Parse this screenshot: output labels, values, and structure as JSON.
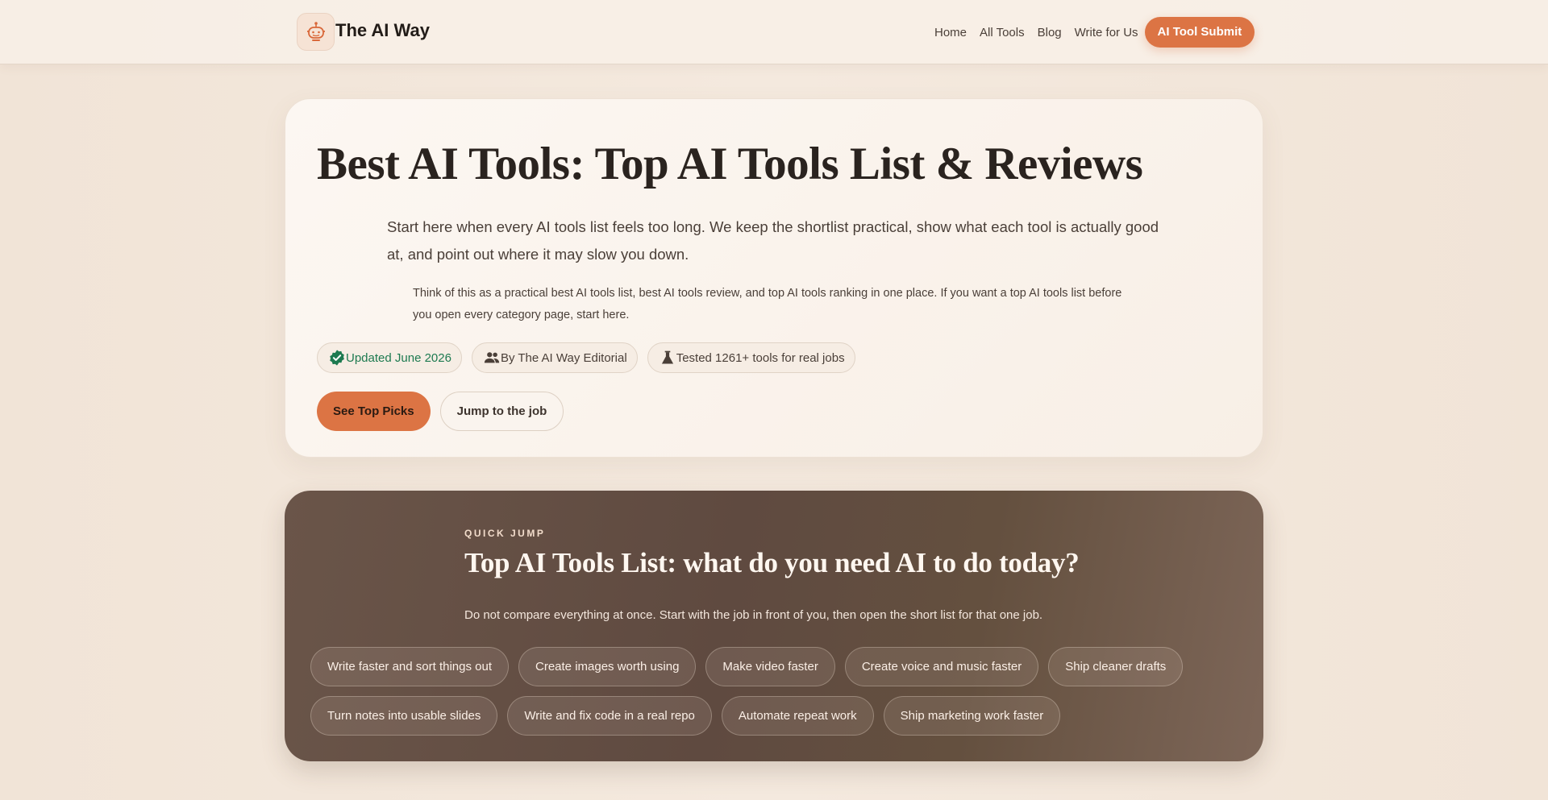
{
  "brand": {
    "name": "The AI Way",
    "logo_icon": "robot-icon"
  },
  "nav": {
    "links": [
      "Home",
      "All Tools",
      "Blog",
      "Write for Us"
    ],
    "cta": "AI Tool Submit"
  },
  "hero": {
    "title": "Best AI Tools: Top AI Tools List & Reviews",
    "lead": "Start here when every AI tools list feels too long. We keep the shortlist practical, show what each tool is actually good at, and point out where it may slow you down.",
    "sub": "Think of this as a practical best AI tools list, best AI tools review, and top AI tools ranking in one place. If you want a top AI tools list before you open every category page, start here.",
    "badges": [
      {
        "label": "Updated June 2026",
        "icon": "verified-check-icon"
      },
      {
        "label": "By The AI Way Editorial",
        "icon": "people-icon"
      },
      {
        "label": "Tested 1261+ tools for real jobs",
        "icon": "flask-icon"
      }
    ],
    "primary_cta": "See Top Picks",
    "secondary_cta": "Jump to the job"
  },
  "quick_jump": {
    "eyebrow": "QUICK JUMP",
    "title": "Top AI Tools List: what do you need AI to do today?",
    "description": "Do not compare everything at once. Start with the job in front of you, then open the short list for that one job.",
    "chips": [
      "Write faster and sort things out",
      "Create images worth using",
      "Make video faster",
      "Create voice and music faster",
      "Ship cleaner drafts",
      "Turn notes into usable slides",
      "Write and fix code in a real repo",
      "Automate repeat work",
      "Ship marketing work faster"
    ]
  },
  "colors": {
    "accent": "#dc7444",
    "verified": "#1d7a50",
    "dark_panel": "#64503f"
  }
}
